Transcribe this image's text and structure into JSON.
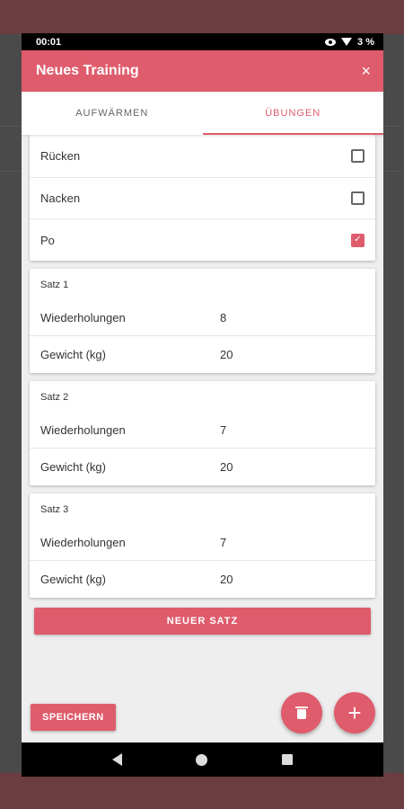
{
  "status_bar": {
    "time": "00:01",
    "battery": "3 %"
  },
  "dialog": {
    "title": "Neues Training",
    "close_symbol": "×"
  },
  "tabs": [
    {
      "label": "AUFWÄRMEN",
      "active": false
    },
    {
      "label": "ÜBUNGEN",
      "active": true
    }
  ],
  "body_parts": [
    {
      "label": "Rücken",
      "checked": false
    },
    {
      "label": "Nacken",
      "checked": false
    },
    {
      "label": "Po",
      "checked": true
    }
  ],
  "sets": [
    {
      "title": "Satz 1",
      "reps_label": "Wiederholungen",
      "reps": "8",
      "weight_label": "Gewicht (kg)",
      "weight": "20"
    },
    {
      "title": "Satz 2",
      "reps_label": "Wiederholungen",
      "reps": "7",
      "weight_label": "Gewicht (kg)",
      "weight": "20"
    },
    {
      "title": "Satz 3",
      "reps_label": "Wiederholungen",
      "reps": "7",
      "weight_label": "Gewicht (kg)",
      "weight": "20"
    }
  ],
  "actions": {
    "new_set_label": "NEUER SATZ",
    "save_label": "SPEICHERN",
    "add_symbol": "+"
  },
  "colors": {
    "accent": "#df5c6c"
  }
}
